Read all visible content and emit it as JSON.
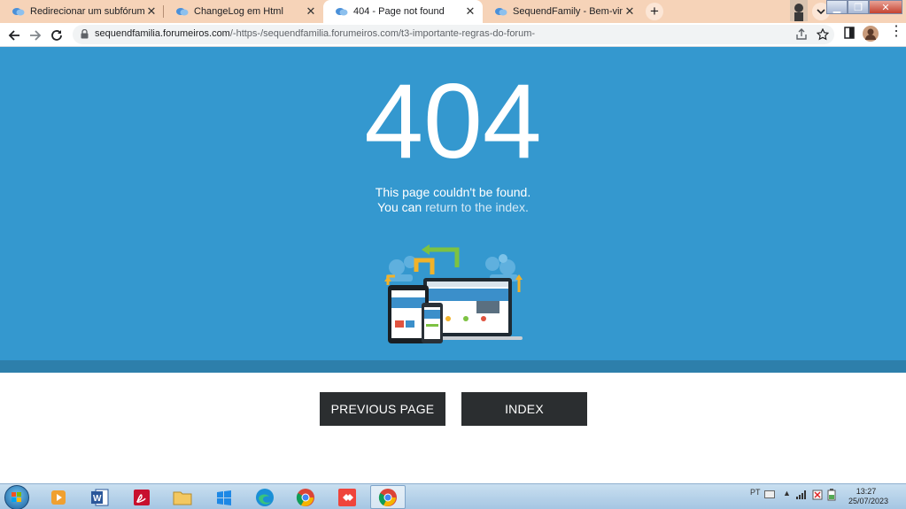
{
  "tabs": [
    {
      "title": "Redirecionar um subfórum para um",
      "active": false
    },
    {
      "title": "ChangeLog em Html",
      "active": false
    },
    {
      "title": "404 - Page not found",
      "active": true
    },
    {
      "title": "SequendFamily - Bem-vindo(a) ao",
      "active": false
    }
  ],
  "address": {
    "host": "sequendfamilia.forumeiros.com",
    "path": "/-https-/sequendfamilia.forumeiros.com/t3-importante-regras-do-forum-"
  },
  "page": {
    "code": "404",
    "line1": "This page couldn't be found.",
    "line2_prefix": "You can ",
    "line2_link": "return to the index.",
    "btn_previous": "PREVIOUS PAGE",
    "btn_index": "INDEX"
  },
  "taskbar": {
    "lang": "PT",
    "time": "13:27",
    "date": "25/07/2023"
  },
  "colors": {
    "banner": "#3498cf",
    "banner_bottom": "#2d7fab",
    "button": "#2b2e30",
    "tabstrip": "#f6d3b8"
  }
}
